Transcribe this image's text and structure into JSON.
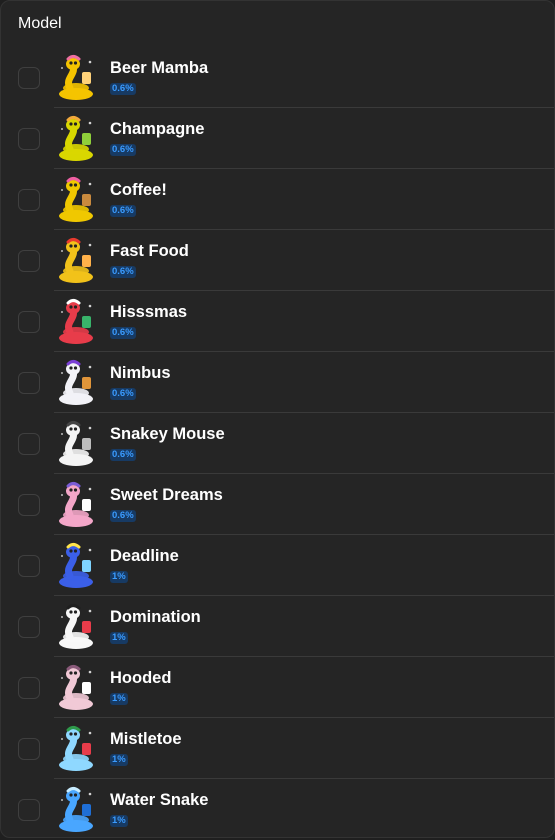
{
  "header": {
    "title": "Model"
  },
  "items": [
    {
      "name": "Beer Mamba",
      "rarity": "0.6%",
      "icon": "beer-mamba-icon",
      "body": "#f5c400",
      "accent": "#f06fa0",
      "prop": "#ffd27a"
    },
    {
      "name": "Champagne",
      "rarity": "0.6%",
      "icon": "champagne-icon",
      "body": "#d9d700",
      "accent": "#f2a93b",
      "prop": "#8fcf3a"
    },
    {
      "name": "Coffee!",
      "rarity": "0.6%",
      "icon": "coffee-icon",
      "body": "#f0c800",
      "accent": "#ef5fa3",
      "prop": "#c98a3e"
    },
    {
      "name": "Fast Food",
      "rarity": "0.6%",
      "icon": "fast-food-icon",
      "body": "#f2c21a",
      "accent": "#e83a2e",
      "prop": "#ffb14a"
    },
    {
      "name": "Hisssmas",
      "rarity": "0.6%",
      "icon": "hisssmas-icon",
      "body": "#e83c4a",
      "accent": "#ffffff",
      "prop": "#38b36a"
    },
    {
      "name": "Nimbus",
      "rarity": "0.6%",
      "icon": "nimbus-icon",
      "body": "#f2f2f7",
      "accent": "#7a3fd6",
      "prop": "#e0953a"
    },
    {
      "name": "Snakey Mouse",
      "rarity": "0.6%",
      "icon": "snakey-mouse-icon",
      "body": "#f4f4f4",
      "accent": "#444444",
      "prop": "#bdbdbd"
    },
    {
      "name": "Sweet Dreams",
      "rarity": "0.6%",
      "icon": "sweet-dreams-icon",
      "body": "#f3a6c8",
      "accent": "#7a5cd6",
      "prop": "#ffffff"
    },
    {
      "name": "Deadline",
      "rarity": "1%",
      "icon": "deadline-icon",
      "body": "#3b5fe8",
      "accent": "#ffe44a",
      "prop": "#7fd4ff"
    },
    {
      "name": "Domination",
      "rarity": "1%",
      "icon": "domination-icon",
      "body": "#f7f7f7",
      "accent": "#1f1f1f",
      "prop": "#e83c4a"
    },
    {
      "name": "Hooded",
      "rarity": "1%",
      "icon": "hooded-icon",
      "body": "#f1c9d6",
      "accent": "#8a5a7a",
      "prop": "#ffffff"
    },
    {
      "name": "Mistletoe",
      "rarity": "1%",
      "icon": "mistletoe-icon",
      "body": "#8fd8ff",
      "accent": "#2e9a4a",
      "prop": "#e83c4a"
    },
    {
      "name": "Water Snake",
      "rarity": "1%",
      "icon": "water-snake-icon",
      "body": "#49a6ff",
      "accent": "#c7ecff",
      "prop": "#1f6fd6"
    }
  ]
}
